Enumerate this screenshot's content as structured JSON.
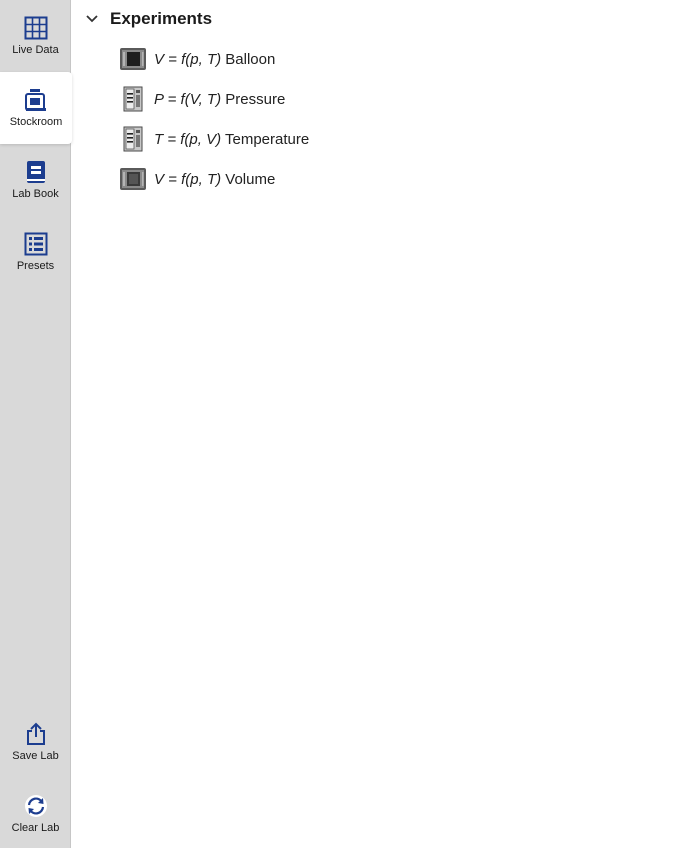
{
  "sidebar": {
    "items": [
      {
        "label": "Live Data",
        "icon": "table-grid-icon"
      },
      {
        "label": "Stockroom",
        "icon": "jar-icon",
        "active": true
      },
      {
        "label": "Lab Book",
        "icon": "notebook-icon"
      },
      {
        "label": "Presets",
        "icon": "list-icon"
      }
    ],
    "bottom_items": [
      {
        "label": "Save Lab",
        "icon": "share-upload-icon"
      },
      {
        "label": "Clear Lab",
        "icon": "refresh-icon"
      }
    ]
  },
  "main": {
    "section_title": "Experiments",
    "experiments": [
      {
        "formula": "V = f(p, T)",
        "name": " Balloon",
        "icon": "balloon-chamber-icon"
      },
      {
        "formula": "P = f(V, T)",
        "name": " Pressure",
        "icon": "pressure-apparatus-icon"
      },
      {
        "formula": "T = f(p, V)",
        "name": " Temperature",
        "icon": "temperature-apparatus-icon"
      },
      {
        "formula": "V = f(p, T)",
        "name": " Volume",
        "icon": "volume-chamber-icon"
      }
    ]
  },
  "colors": {
    "accent": "#1c3d8f",
    "sidebar_bg": "#d9d9d9",
    "active_bg": "#ffffff"
  }
}
